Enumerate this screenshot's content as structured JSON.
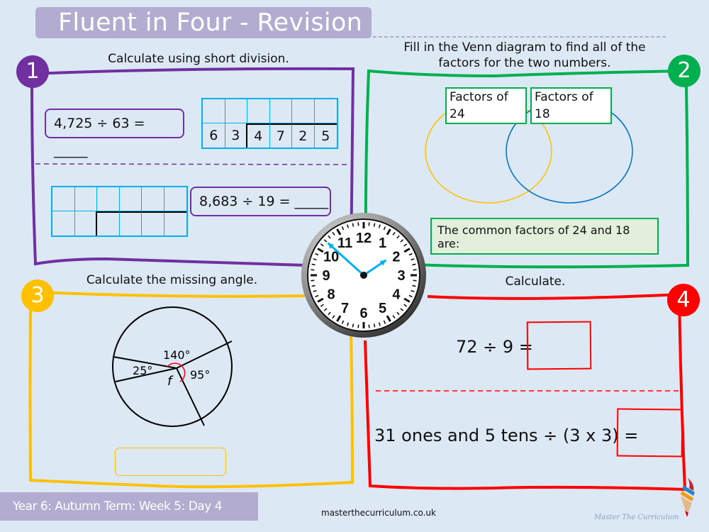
{
  "header": {
    "title": "Fluent in Four - Revision"
  },
  "sections": [
    {
      "number": "1",
      "color": "#7030a0",
      "instruction": "Calculate using short division.",
      "problems": [
        {
          "text": "4,725 ÷ 63 = _____",
          "grid_top": [
            "",
            "",
            "",
            "",
            "",
            ""
          ],
          "grid_bottom": [
            "6",
            "3",
            "4",
            "7",
            "2",
            "5"
          ]
        },
        {
          "text": "8,683 ÷ 19 = _____",
          "grid_top": [
            "",
            "",
            "",
            "",
            "",
            ""
          ],
          "grid_bottom": [
            "",
            "",
            "",
            "",
            "",
            ""
          ]
        }
      ]
    },
    {
      "number": "2",
      "color": "#00b050",
      "instruction_line1": "Fill in the Venn diagram to find all of the",
      "instruction_line2": "factors for the two numbers.",
      "venn_left_label": "Factors of 24",
      "venn_right_label": "Factors of 18",
      "venn_left_color": "#ffc000",
      "venn_right_color": "#0070c0",
      "common_text": "The common factors of 24 and 18 are:"
    },
    {
      "number": "3",
      "color": "#ffc000",
      "instruction": "Calculate the missing angle.",
      "angles": {
        "top": "140°",
        "left": "25°",
        "right": "95°",
        "unknown": "f"
      },
      "answer": ""
    },
    {
      "number": "4",
      "color": "#ff0000",
      "instruction": "Calculate.",
      "problems": [
        {
          "text": "72 ÷ 9 =",
          "answer": ""
        },
        {
          "text": "31 ones and 5 tens ÷ (3 x 3) =",
          "answer": ""
        }
      ]
    }
  ],
  "clock": {
    "hours": 1,
    "minutes": 52,
    "numerals": [
      "12",
      "1",
      "2",
      "3",
      "4",
      "5",
      "6",
      "7",
      "8",
      "9",
      "10",
      "11"
    ],
    "hand_color": "#00b0f0"
  },
  "footer": {
    "lesson": "Year 6: Autumn Term: Week 5: Day 4",
    "url": "masterthecurriculum.co.uk",
    "brand": "Master  The  Curriculum"
  }
}
